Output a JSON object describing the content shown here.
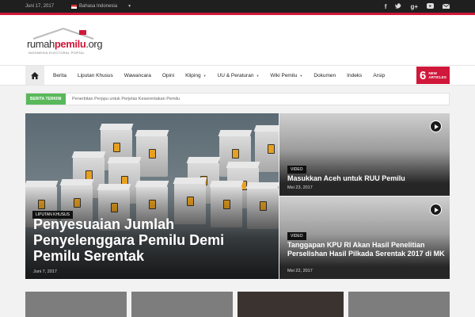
{
  "topbar": {
    "date": "Juni 17, 2017",
    "language": "Bahasa Indonesia"
  },
  "social": [
    "facebook-icon",
    "twitter-icon",
    "google-plus-icon",
    "youtube-icon",
    "mail-icon"
  ],
  "logo": {
    "part1": "rumah",
    "part2": "pemilu",
    "part3": ".org",
    "tagline": "INDONESIA ELECTORAL PORTAL"
  },
  "nav": {
    "items": [
      {
        "label": "Berita"
      },
      {
        "label": "Liputan Khusus"
      },
      {
        "label": "Wawancara"
      },
      {
        "label": "Opini"
      },
      {
        "label": "Kliping"
      },
      {
        "label": "UU & Peraturan"
      },
      {
        "label": "Wiki Pemilu"
      },
      {
        "label": "Dokumen"
      },
      {
        "label": "Indeks"
      },
      {
        "label": "Arsip"
      }
    ],
    "new_count": "6",
    "new_label_1": "NEW",
    "new_label_2": "ARTICLES"
  },
  "ticker": {
    "tag": "BERITA TERKINI",
    "headline": "Penerbitan Perppu untuk Perjelas Keserentakan Pemilu"
  },
  "featured": {
    "category": "LIPUTAN KHUSUS",
    "title": "Penyesuaian Jumlah Penyelenggara Pemilu Demi Pemilu Serentak",
    "date": "Juni 7, 2017"
  },
  "side": [
    {
      "category": "VIDEO",
      "title": "Masukkan Aceh untuk RUU Pemilu",
      "date": "Mei 23, 2017"
    },
    {
      "category": "VIDEO",
      "title": "Tanggapan KPU RI Akan Hasil Penelitian Perselishan Hasil Pilkada Serentak 2017 di MK",
      "date": "Mei 22, 2017"
    }
  ],
  "colors": {
    "accent": "#d0183a",
    "ticker_tag": "#58b85a"
  }
}
